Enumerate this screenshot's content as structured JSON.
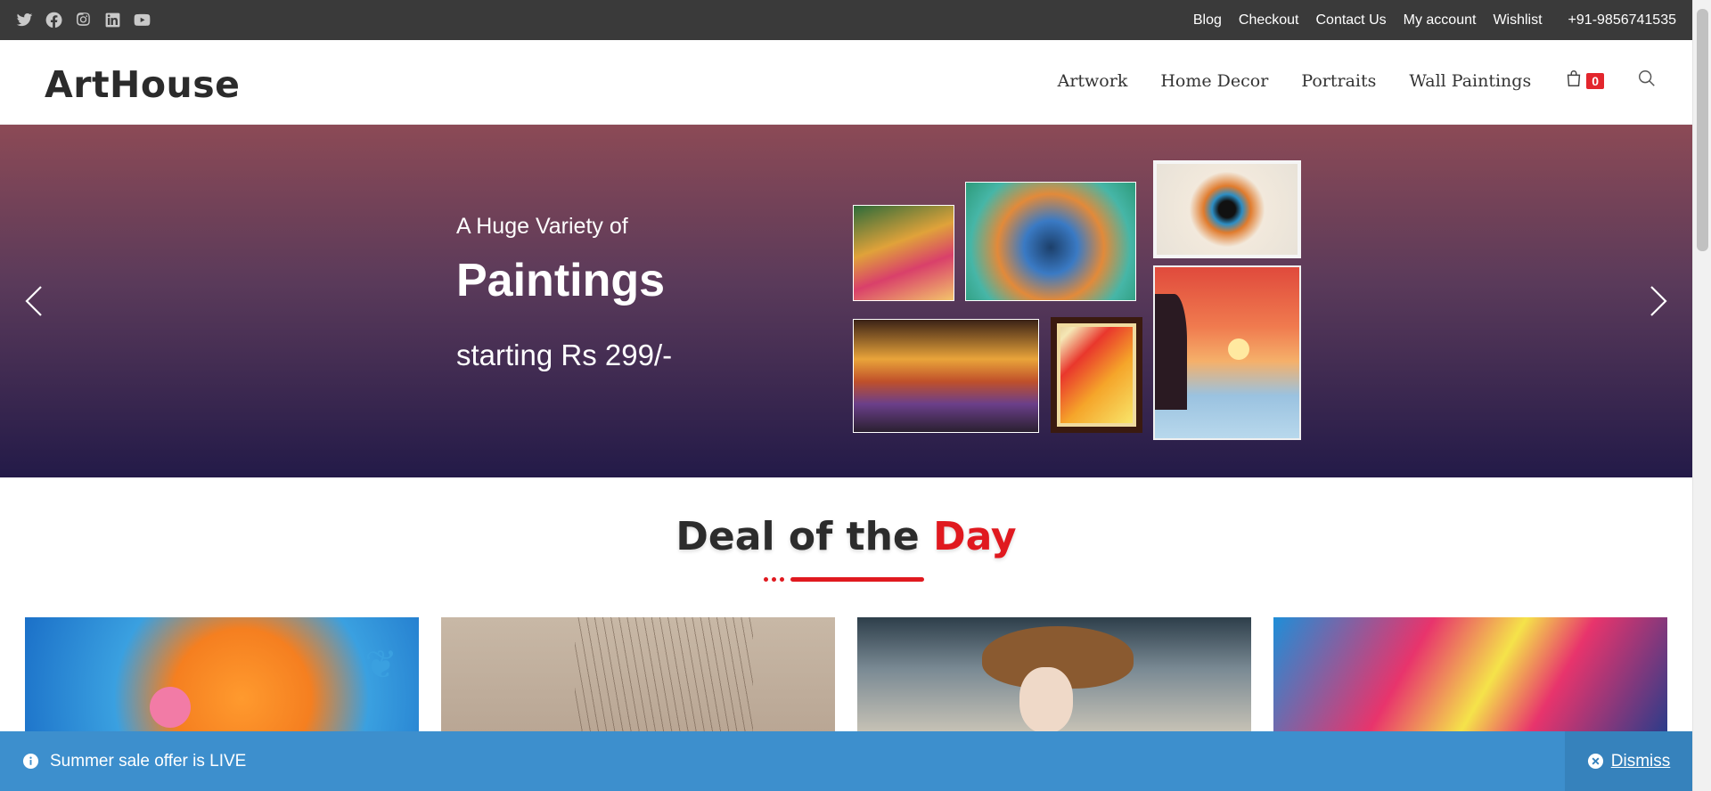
{
  "topbar": {
    "social": [
      "twitter-icon",
      "facebook-icon",
      "instagram-icon",
      "linkedin-icon",
      "youtube-icon"
    ],
    "links": [
      "Blog",
      "Checkout",
      "Contact Us",
      "My account",
      "Wishlist"
    ],
    "phone": "+91-9856741535"
  },
  "header": {
    "logo": "ArtHouse",
    "nav": [
      "Artwork",
      "Home Decor",
      "Portraits",
      "Wall Paintings"
    ],
    "cart_count": "0"
  },
  "hero": {
    "subtitle": "A Huge Variety of",
    "title": "Paintings",
    "price": "starting Rs 299/-"
  },
  "deal": {
    "title_part1": "Deal of the ",
    "title_part2": "Day",
    "accent_color": "#e0191f"
  },
  "notice": {
    "message": "Summer sale offer is LIVE",
    "dismiss": "Dismiss",
    "bg_color": "#3d8fcd"
  }
}
